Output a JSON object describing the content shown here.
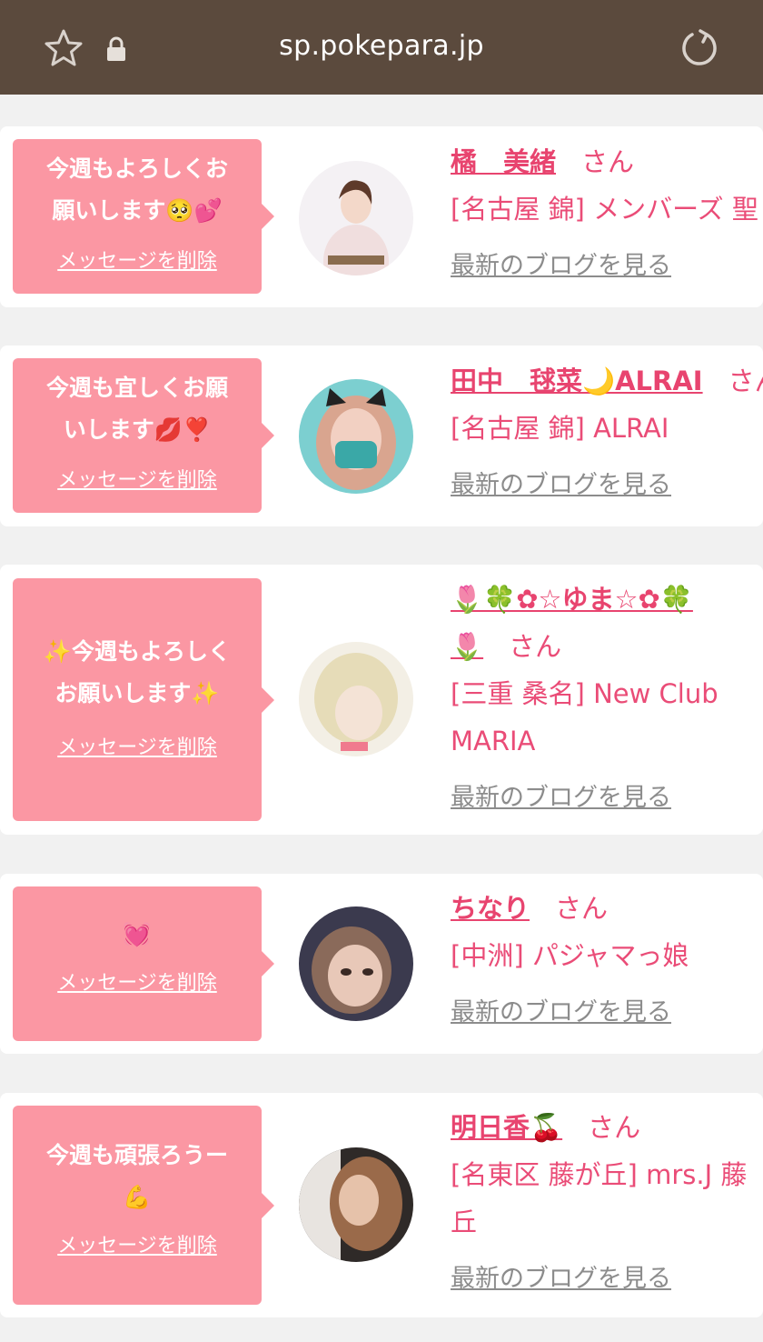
{
  "browser": {
    "url": "sp.pokepara.jp",
    "icons": [
      "star-icon",
      "lock-icon",
      "reload-icon"
    ]
  },
  "colors": {
    "topbar": "#5b4a3d",
    "bubble": "#fb97a3",
    "accent": "#e8446f",
    "blog_link": "#8c8c8c"
  },
  "labels": {
    "delete": "メッセージを削除",
    "blog": "最新のブログを見る",
    "san": "さん"
  },
  "items": [
    {
      "message_lines": [
        "今週もよろしくお",
        "願いします🥺💕"
      ],
      "name": "橘　美緒",
      "shop": "[名古屋 錦] メンバーズ 聖"
    },
    {
      "message_lines": [
        "今週も宜しくお願",
        "いします💋❣️"
      ],
      "name": "田中　毬菜🌙ALRAI",
      "shop": "[名古屋 錦] ALRAI"
    },
    {
      "message_lines": [
        "✨今週もよろしく",
        "お願いします✨"
      ],
      "name_lines": [
        "🌷🍀✿☆ゆま☆✿🍀",
        "🌷"
      ],
      "shop_lines": [
        "[三重 桑名] New Club",
        "MARIA"
      ]
    },
    {
      "message_lines": [
        "💓"
      ],
      "name": "ちなり",
      "shop": "[中洲] パジャマっ娘"
    },
    {
      "message_lines": [
        "今週も頑張ろうー",
        "💪"
      ],
      "name": "明日香🍒",
      "shop_lines": [
        "[名東区 藤が丘] mrs.J 藤",
        "丘"
      ]
    }
  ]
}
